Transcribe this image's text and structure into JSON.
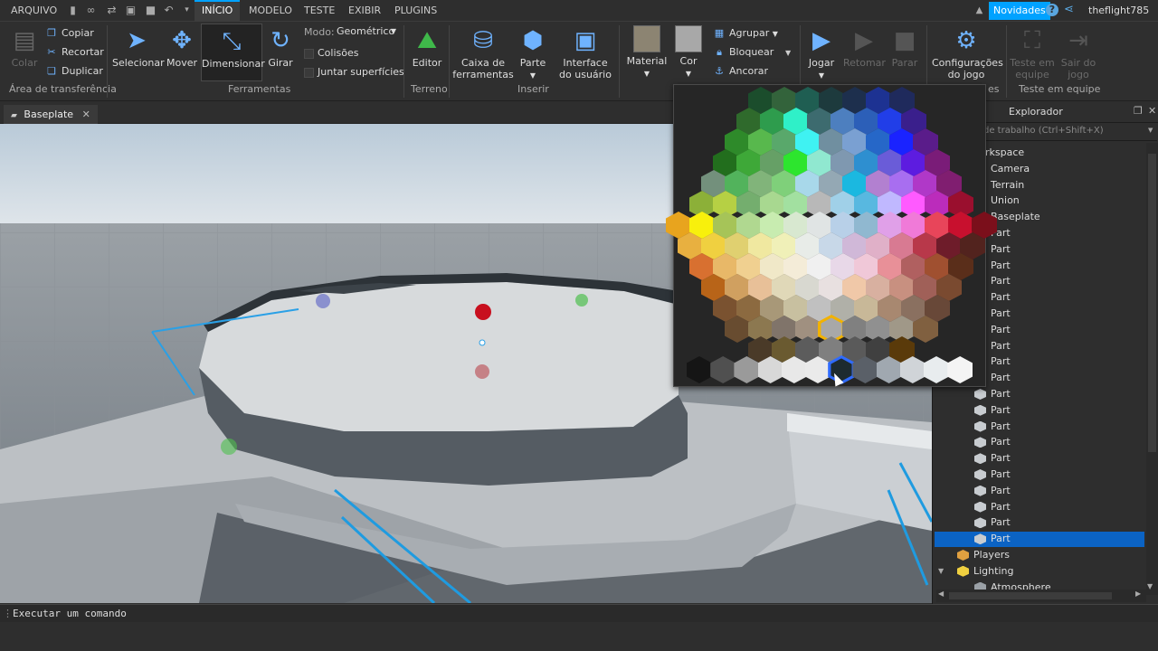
{
  "menubar": {
    "file_label": "ARQUIVO",
    "tabs": [
      {
        "label": "INÍCIO",
        "active": true
      },
      {
        "label": "MODELO",
        "active": false
      },
      {
        "label": "TESTE",
        "active": false
      },
      {
        "label": "EXIBIR",
        "active": false
      },
      {
        "label": "PLUGINS",
        "active": false
      }
    ],
    "news_label": "Novidades",
    "username": "theflight785"
  },
  "ribbon": {
    "clipboard": {
      "paste": "Colar",
      "copy": "Copiar",
      "cut": "Recortar",
      "duplicate": "Duplicar",
      "group_label": "Área de transferência"
    },
    "tools": {
      "select": "Selecionar",
      "move": "Mover",
      "scale": "Dimensionar",
      "rotate": "Girar",
      "mode_label": "Modo:",
      "mode_value": "Geométrico",
      "collisions": "Colisões",
      "join_surfaces": "Juntar superfícies",
      "group_label": "Ferramentas"
    },
    "terrain": {
      "editor": "Editor",
      "group_label": "Terreno"
    },
    "insert": {
      "toolbox_line1": "Caixa de",
      "toolbox_line2": "ferramentas",
      "part": "Parte",
      "ui_line1": "Interface",
      "ui_line2": "do usuário",
      "group_label": "Inserir"
    },
    "edit": {
      "material": "Material",
      "color": "Cor",
      "group": "Agrupar",
      "lock": "Bloquear",
      "anchor": "Ancorar"
    },
    "test": {
      "play": "Jogar",
      "resume": "Retomar",
      "stop": "Parar"
    },
    "settings": {
      "line1": "Configurações",
      "line2": "do jogo",
      "group_label_partial": "es"
    },
    "team_test": {
      "test_line1": "Teste em",
      "test_line2": "equipe",
      "exit_line1": "Sair do",
      "exit_line2": "jogo",
      "group_label": "Teste em equipe"
    }
  },
  "document_tab": {
    "title": "Baseplate"
  },
  "explorer": {
    "title": "Explorador",
    "filter_placeholder": "de trabalho (Ctrl+Shift+X)",
    "workspace_partial": "rkspace",
    "items": [
      "Camera",
      "Terrain",
      "Union",
      "Baseplate"
    ],
    "part_label": "Part",
    "part_count": 20,
    "selected_part_index": 19,
    "players": "Players",
    "lighting": "Lighting",
    "atmosphere": "Atmosphere"
  },
  "command_bar": {
    "placeholder": "Executar um comando"
  },
  "colors": {
    "accent": "#00a2ff",
    "selection": "#0b63c4",
    "palette_selected_ring": "#f2b200",
    "palette_hover_ring": "#2f6bff",
    "palette_bg": "#262626"
  },
  "palette": {
    "rows": [
      [
        "#1b4d2c",
        "#33633b",
        "#1f5e52",
        "#1d3a3d",
        "#1d2f4d",
        "#1d3292",
        "#1f2a5c"
      ],
      [
        "#2f6a2c",
        "#2e9c4d",
        "#2ff0c8",
        "#3d6b6f",
        "#4d7fbf",
        "#2c5fb8",
        "#213ee8",
        "#3a1f8c"
      ],
      [
        "#2e8a2a",
        "#58b84d",
        "#59a86b",
        "#3ff2f2",
        "#708fa0",
        "#7aa0d2",
        "#2667c8",
        "#1a23ff",
        "#5a1c8a"
      ],
      [
        "#226e1d",
        "#3ea838",
        "#66a066",
        "#2de52e",
        "#90e8d0",
        "#7f98b0",
        "#2e8fd0",
        "#6a5cd8",
        "#5d1ce0",
        "#7a1c78"
      ],
      [
        "#73907c",
        "#52b35c",
        "#81b47a",
        "#7fd07a",
        "#a8d8ea",
        "#94a8b4",
        "#1bb8e0",
        "#b280d0",
        "#a86ef0",
        "#b038c8",
        "#801e70"
      ],
      [
        "#8cb038",
        "#b6d044",
        "#74ae6e",
        "#a8d890",
        "#a2e0a0",
        "#b8b8b8",
        "#a0d0e8",
        "#58b8e0",
        "#c0b8ff",
        "#ff5aff",
        "#bb2cbb",
        "#9a0f2e"
      ],
      [
        "#e8a41e",
        "#f8f00c",
        "#a6c458",
        "#b0d890",
        "#c8ecb0",
        "#d8e8d0",
        "#e0e4e4",
        "#b8d0e8",
        "#90b8d0",
        "#e0a0e8",
        "#f07ad8",
        "#e8455a",
        "#c8102e",
        "#7b0f1b"
      ],
      [
        "#e8b040",
        "#f0d040",
        "#e0d070",
        "#f0e8a0",
        "#f0f0b8",
        "#e8ece8",
        "#c8d8e8",
        "#d0b8d8",
        "#e0b0c8",
        "#d87a92",
        "#b8384a",
        "#6e1c2a",
        "#52231e"
      ],
      [
        "#d87030",
        "#e8b868",
        "#f0d090",
        "#f0e8c8",
        "#f4ecd8",
        "#f0f0f0",
        "#e8d8e8",
        "#f0c8d8",
        "#e89098",
        "#b06060",
        "#a05030",
        "#5a2e1a"
      ],
      [
        "#b86418",
        "#d0a060",
        "#e8c098",
        "#e0d8b8",
        "#d8d8d0",
        "#e8e0e0",
        "#f0c8a8",
        "#d8b0a0",
        "#c89080",
        "#a06058",
        "#7a4a30"
      ],
      [
        "#7a5230",
        "#8c6a40",
        "#a89878",
        "#c8c0a0",
        "#c0c0c0",
        "#b0b0a8",
        "#c8b898",
        "#a88870",
        "#8a7060",
        "#684838"
      ],
      [
        "#684c30",
        "#8c7850",
        "#80746a",
        "#a09080",
        "#a8a8a8",
        "#808080",
        "#909090",
        "#a09888",
        "#806040"
      ],
      [
        "#4a3a28",
        "#6a5a30",
        "#5c5c5c",
        "#7f7f7f",
        "#5a5a5a",
        "#404040",
        "#5a3a0a"
      ]
    ],
    "bottom_row": [
      "#151515",
      "#505050",
      "#9a9a9a",
      "#d8d8d8",
      "#e8e8e8",
      "#eaeaea",
      "#1d2b30",
      "#5a6068",
      "#a0a8b0",
      "#d0d4d8",
      "#e8ecee",
      "#f4f4f4"
    ]
  }
}
